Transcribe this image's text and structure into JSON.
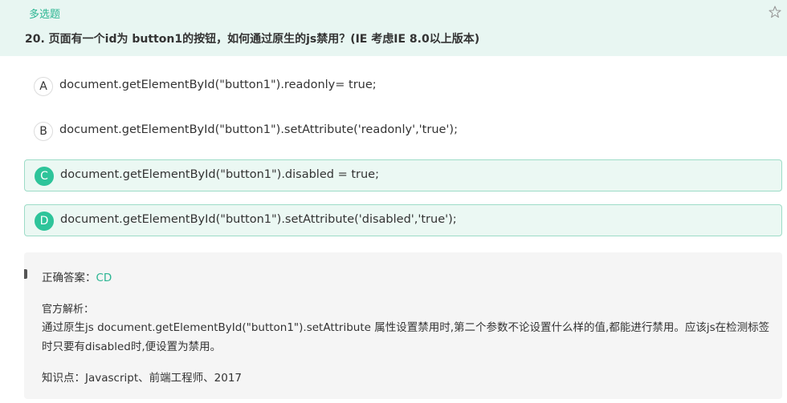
{
  "question": {
    "type_tag": "多选题",
    "title": "20. 页面有一个id为 button1的按钮，如何通过原生的js禁用？(IE 考虑IE 8.0以上版本)",
    "star_icon": "star-outline-icon"
  },
  "options": [
    {
      "letter": "A",
      "text": "document.getElementById(\"button1\").readonly= true;",
      "selected": false
    },
    {
      "letter": "B",
      "text": "document.getElementById(\"button1\").setAttribute('readonly','true');",
      "selected": false
    },
    {
      "letter": "C",
      "text": "document.getElementById(\"button1\").disabled = true;",
      "selected": true
    },
    {
      "letter": "D",
      "text": "document.getElementById(\"button1\").setAttribute('disabled','true');",
      "selected": true
    }
  ],
  "analysis": {
    "answer_label": "正确答案：",
    "answer_value": "CD",
    "explanation_label": "官方解析：",
    "explanation": "通过原生js document.getElementById(\"button1\").setAttribute 属性设置禁用时,第二个参数不论设置什么样的值,都能进行禁用。应该js在检测标签时只要有disabled时,便设置为禁用。",
    "knowledge": "知识点：Javascript、前端工程师、2017"
  },
  "colors": {
    "accent": "#2ec49a",
    "header_bg": "#e8f6f2",
    "selected_bg": "#ebf8f3",
    "selected_border": "#9ddcc7",
    "panel_bg": "#f5f5f5"
  }
}
